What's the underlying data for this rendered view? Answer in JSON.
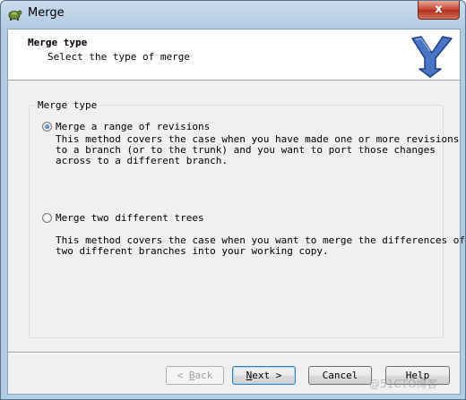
{
  "window": {
    "title": "Merge",
    "close_label": "x"
  },
  "header": {
    "title": "Merge type",
    "subtitle": "Select the type of merge"
  },
  "group": {
    "label": "Merge type",
    "options": [
      {
        "label": "Merge a range of revisions",
        "checked": true,
        "description": "This method covers the case when you have made one or more revisions\nto a branch (or to the trunk) and you want to port those changes\nacross to a different branch."
      },
      {
        "label": "Merge two different trees",
        "checked": false,
        "description": "This method covers the case when you want to merge the differences of\ntwo different branches into your working copy."
      }
    ]
  },
  "buttons": {
    "back": {
      "prefix": "< ",
      "mnemonic": "B",
      "rest": "ack",
      "enabled": false
    },
    "next": {
      "mnemonic": "N",
      "rest": "ext >",
      "default": true
    },
    "cancel": {
      "label": "Cancel"
    },
    "help": {
      "label": "Help"
    }
  },
  "watermark": "@51CTO博客"
}
